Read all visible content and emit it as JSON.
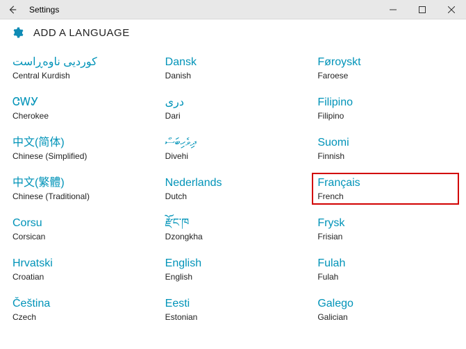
{
  "window": {
    "title": "Settings"
  },
  "page": {
    "heading": "ADD A LANGUAGE"
  },
  "columns": [
    [
      {
        "native": "کوردیی ناوەڕاست",
        "english": "Central Kurdish"
      },
      {
        "native": "ᏣᎳᎩ",
        "english": "Cherokee"
      },
      {
        "native": "中文(简体)",
        "english": "Chinese (Simplified)"
      },
      {
        "native": "中文(繁體)",
        "english": "Chinese (Traditional)"
      },
      {
        "native": "Corsu",
        "english": "Corsican"
      },
      {
        "native": "Hrvatski",
        "english": "Croatian"
      },
      {
        "native": "Čeština",
        "english": "Czech"
      }
    ],
    [
      {
        "native": "Dansk",
        "english": "Danish"
      },
      {
        "native": "درى",
        "english": "Dari"
      },
      {
        "native": "ދިވެހިބަސް",
        "english": "Divehi"
      },
      {
        "native": "Nederlands",
        "english": "Dutch"
      },
      {
        "native": "རྫོང་ཁ",
        "english": "Dzongkha"
      },
      {
        "native": "English",
        "english": "English"
      },
      {
        "native": "Eesti",
        "english": "Estonian"
      }
    ],
    [
      {
        "native": "Føroyskt",
        "english": "Faroese"
      },
      {
        "native": "Filipino",
        "english": "Filipino"
      },
      {
        "native": "Suomi",
        "english": "Finnish"
      },
      {
        "native": "Français",
        "english": "French"
      },
      {
        "native": "Frysk",
        "english": "Frisian"
      },
      {
        "native": "Fulah",
        "english": "Fulah"
      },
      {
        "native": "Galego",
        "english": "Galician"
      }
    ]
  ]
}
